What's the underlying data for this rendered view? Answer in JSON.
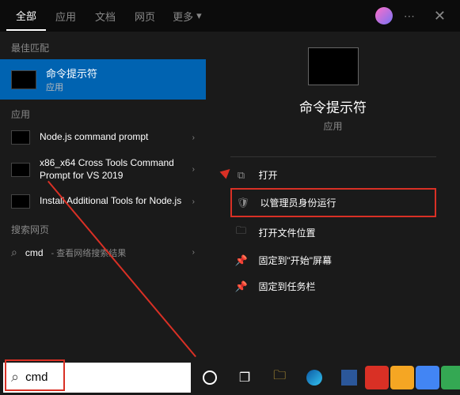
{
  "tabs": {
    "all": "全部",
    "apps": "应用",
    "docs": "文档",
    "web": "网页",
    "more": "更多"
  },
  "sections": {
    "best_match": "最佳匹配",
    "apps": "应用",
    "web": "搜索网页"
  },
  "best_match": {
    "title": "命令提示符",
    "subtitle": "应用"
  },
  "app_results": [
    {
      "name": "Node.js command prompt"
    },
    {
      "name": "x86_x64 Cross Tools Command Prompt for VS 2019"
    },
    {
      "name": "Install Additional Tools for Node.js"
    }
  ],
  "web_result": {
    "query": "cmd",
    "hint": " - 查看网络搜索结果"
  },
  "detail": {
    "title": "命令提示符",
    "subtitle": "应用"
  },
  "actions": {
    "open": "打开",
    "run_admin": "以管理员身份运行",
    "open_location": "打开文件位置",
    "pin_start": "固定到\"开始\"屏幕",
    "pin_taskbar": "固定到任务栏"
  },
  "search": {
    "value": "cmd",
    "icon": "⌕"
  }
}
